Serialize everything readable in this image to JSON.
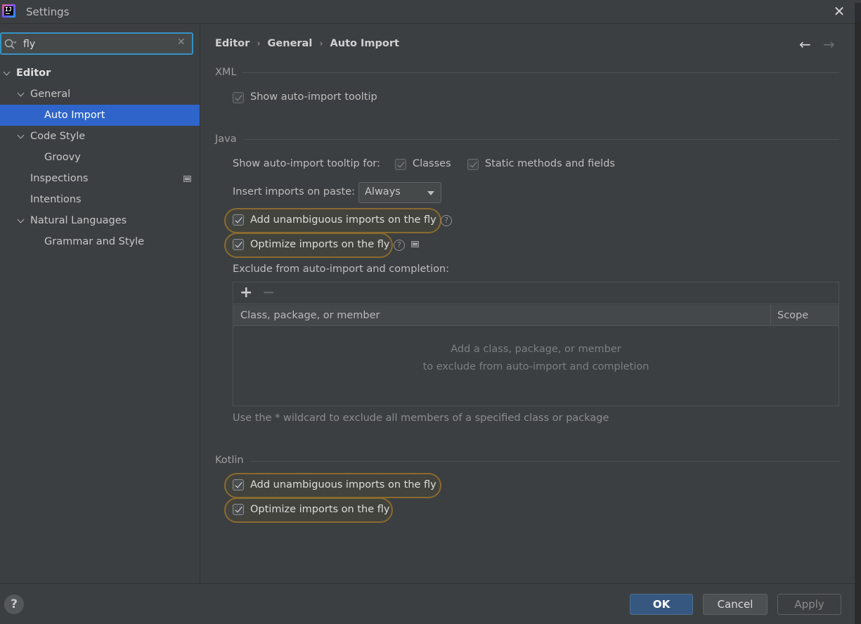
{
  "window": {
    "title": "Settings"
  },
  "search": {
    "value": "fly"
  },
  "sidebar": {
    "items": [
      {
        "label": "Editor"
      },
      {
        "label": "General"
      },
      {
        "label": "Auto Import"
      },
      {
        "label": "Code Style"
      },
      {
        "label": "Groovy"
      },
      {
        "label": "Inspections"
      },
      {
        "label": "Intentions"
      },
      {
        "label": "Natural Languages"
      },
      {
        "label": "Grammar and Style"
      }
    ],
    "selected": "Auto Import"
  },
  "breadcrumb": [
    "Editor",
    "General",
    "Auto Import"
  ],
  "xml": {
    "heading": "XML",
    "show_tooltip": {
      "label": "Show auto-import tooltip",
      "checked": true
    }
  },
  "java": {
    "heading": "Java",
    "tooltip_for_label": "Show auto-import tooltip for:",
    "classes": {
      "label": "Classes",
      "checked": true
    },
    "static_members": {
      "label": "Static methods and fields",
      "checked": true
    },
    "insert_on_paste_label": "Insert imports on paste:",
    "insert_on_paste_value": "Always",
    "add_unambiguous": {
      "label": "Add unambiguous imports on the fly",
      "checked": true
    },
    "optimize": {
      "label": "Optimize imports on the fly",
      "checked": true
    },
    "exclude_label": "Exclude from auto-import and completion:",
    "exclude_table": {
      "columns": [
        "Class, package, or member",
        "Scope"
      ],
      "empty_line1": "Add a class, package, or member",
      "empty_line2": "to exclude from auto-import and completion"
    },
    "wildcard_hint": "Use the * wildcard to exclude all members of a specified class or package"
  },
  "kotlin": {
    "heading": "Kotlin",
    "add_unambiguous": {
      "label": "Add unambiguous imports on the fly",
      "checked": true
    },
    "optimize": {
      "label": "Optimize imports on the fly",
      "checked": true
    }
  },
  "buttons": {
    "ok": "OK",
    "cancel": "Cancel",
    "apply": "Apply",
    "help": "?"
  },
  "icons": {
    "app": "intellij-idea-icon",
    "close": "close-icon",
    "search": "search-icon",
    "clear": "clear-icon",
    "back": "arrow-left-icon",
    "forward": "arrow-right-icon",
    "add": "plus-icon",
    "remove": "minus-icon",
    "help": "question-mark-icon"
  },
  "colors": {
    "selection": "#2f65ca",
    "search_focus": "#3592c4",
    "highlight": "#8a6b2e",
    "ok_button": "#365880"
  }
}
